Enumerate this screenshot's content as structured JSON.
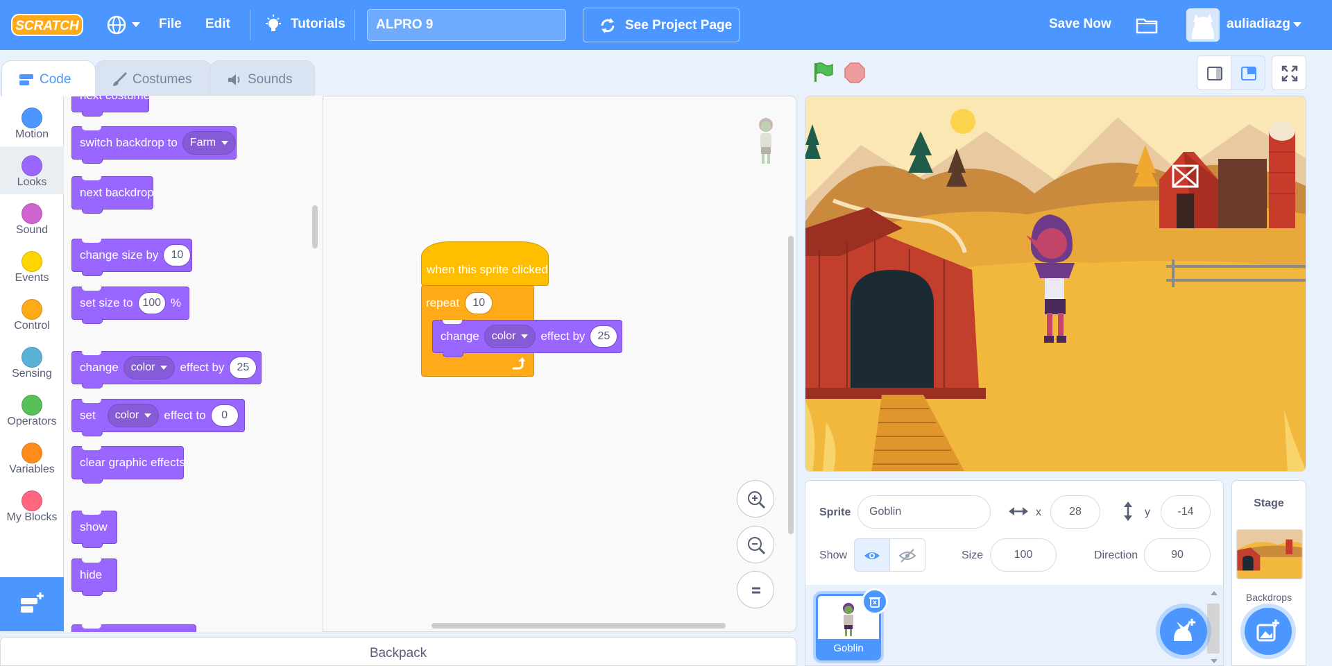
{
  "menubar": {
    "file": "File",
    "edit": "Edit",
    "tutorials": "Tutorials",
    "project_title": "ALPRO 9",
    "see_project": "See Project Page",
    "save_now": "Save Now",
    "username": "auliadiazg"
  },
  "tabs": {
    "code": "Code",
    "costumes": "Costumes",
    "sounds": "Sounds"
  },
  "categories": [
    {
      "label": "Motion",
      "color": "#4c97ff"
    },
    {
      "label": "Looks",
      "color": "#9966ff"
    },
    {
      "label": "Sound",
      "color": "#cf63cf"
    },
    {
      "label": "Events",
      "color": "#ffd500"
    },
    {
      "label": "Control",
      "color": "#ffab19"
    },
    {
      "label": "Sensing",
      "color": "#5cb1d6"
    },
    {
      "label": "Operators",
      "color": "#59c059"
    },
    {
      "label": "Variables",
      "color": "#ff8c1a"
    },
    {
      "label": "My Blocks",
      "color": "#ff6680"
    }
  ],
  "palette": {
    "next_costume": "next costume",
    "switch_backdrop": "switch backdrop to",
    "backdrop_value": "Farm",
    "next_backdrop": "next backdrop",
    "change_size": "change size by",
    "change_size_value": "10",
    "set_size": "set size to",
    "set_size_value": "100",
    "percent": "%",
    "change_effect": "change",
    "effect_by": "effect by",
    "effect_value": "color",
    "change_effect_amount": "25",
    "set_effect": "set",
    "effect_to": "effect to",
    "set_effect_amount": "0",
    "clear_effects": "clear graphic effects",
    "show": "show",
    "hide": "hide"
  },
  "script": {
    "hat": "when this sprite clicked",
    "repeat": "repeat",
    "repeat_count": "10",
    "change": "change",
    "effect": "color",
    "effect_by": "effect by",
    "amount": "25"
  },
  "backpack": "Backpack",
  "sprite_info": {
    "sprite_label": "Sprite",
    "sprite_name": "Goblin",
    "x_label": "x",
    "x": "28",
    "y_label": "y",
    "y": "-14",
    "show_label": "Show",
    "size_label": "Size",
    "size": "100",
    "direction_label": "Direction",
    "direction": "90"
  },
  "sprites": [
    {
      "name": "Goblin"
    }
  ],
  "stage_panel": {
    "title": "Stage",
    "backdrops": "Backdrops"
  },
  "colors": {
    "accent": "#4c97ff",
    "looks": "#9966ff",
    "events": "#ffbf00",
    "control": "#ffab19"
  }
}
